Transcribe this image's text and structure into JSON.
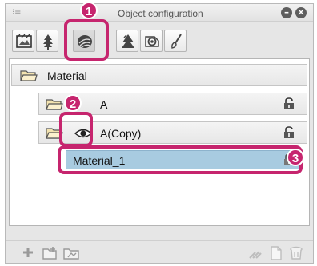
{
  "panel": {
    "title": "Object configuration",
    "grip_icon": "grip-icon",
    "buttons": [
      "minimize-icon",
      "close-icon"
    ]
  },
  "toolbar": {
    "tools": [
      {
        "name": "frame-tool-icon"
      },
      {
        "name": "tree-tool-icon"
      },
      {
        "name": "material-tool-icon",
        "active": true
      },
      {
        "name": "tree-large-icon"
      },
      {
        "name": "ring-tool-icon"
      },
      {
        "name": "brush-tool-icon"
      }
    ]
  },
  "tree": {
    "rows": [
      {
        "label": "Material",
        "icon": "folder-icon"
      },
      {
        "label": "A",
        "icon": "folder-icon"
      },
      {
        "label": "A(Copy)",
        "icon": "folder-icon",
        "visibility_icon": "eye-icon"
      },
      {
        "label": "Material_1",
        "selected": true
      }
    ]
  },
  "bottom": {
    "icons": [
      "add-icon",
      "new-folder-icon",
      "duplicate-folder-icon",
      "link-icon",
      "page-icon",
      "trash-icon"
    ]
  },
  "annotations": {
    "badges": [
      "1",
      "2",
      "3"
    ]
  },
  "colors": {
    "highlight": "#c6256e",
    "selected_row": "#a8cbe0"
  }
}
